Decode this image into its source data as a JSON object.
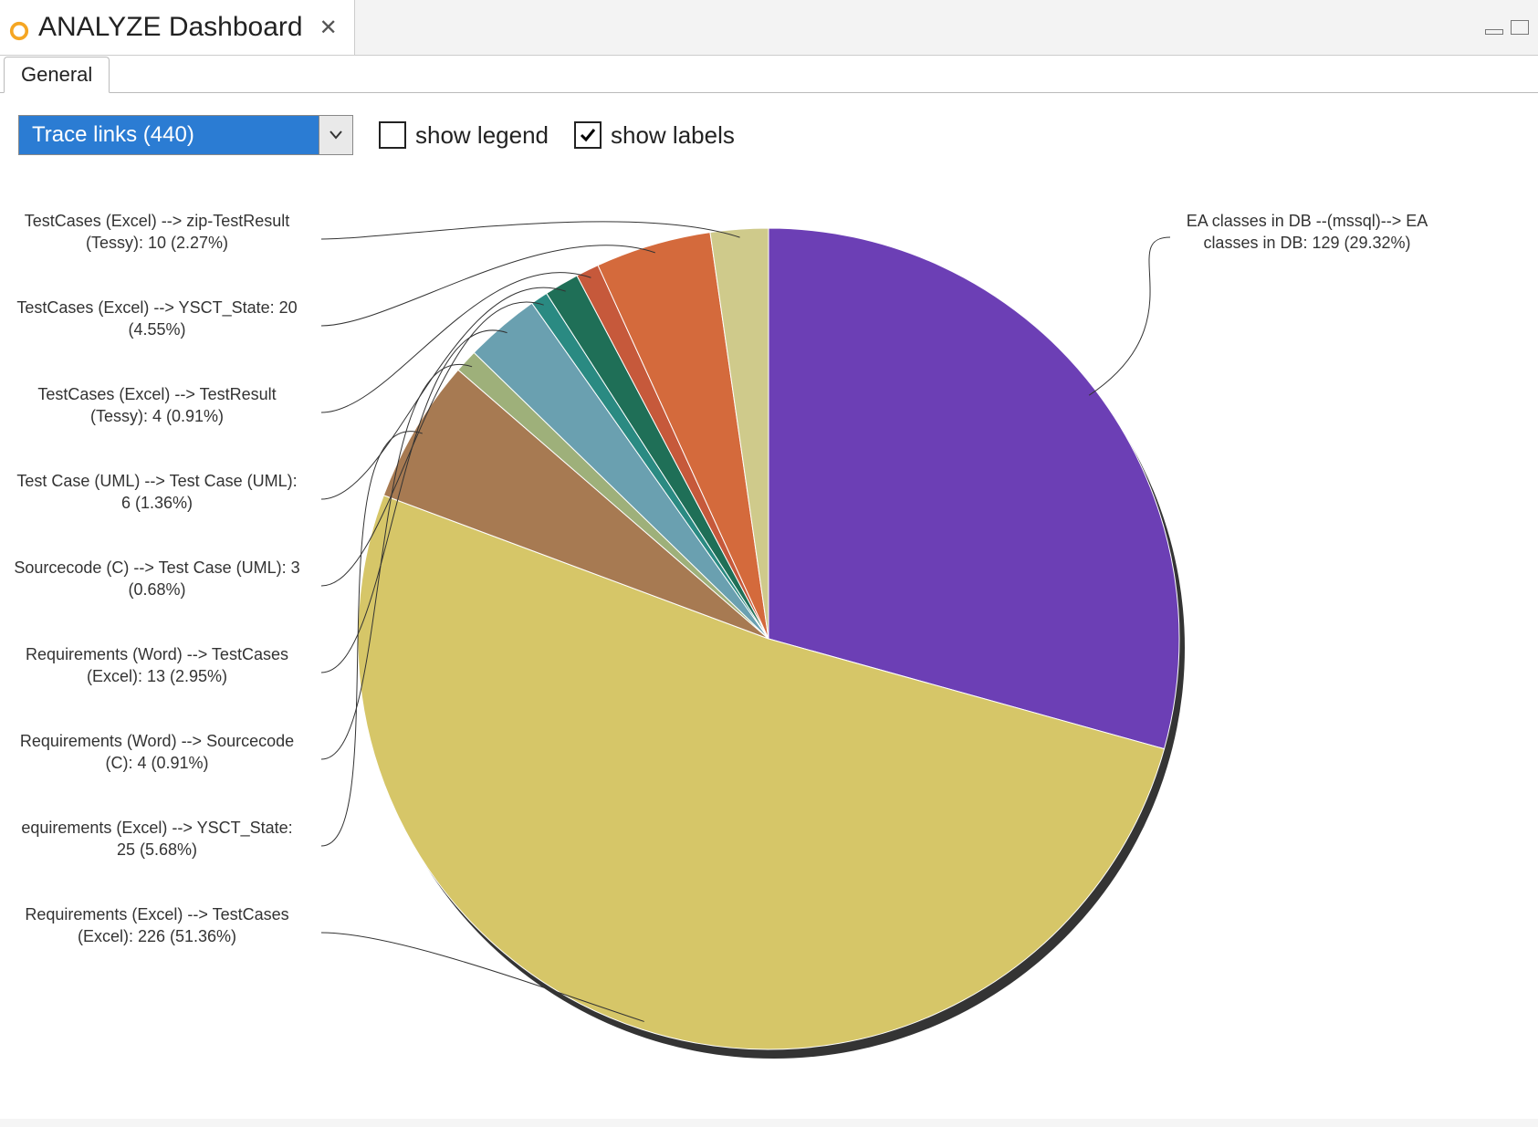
{
  "window": {
    "title": "ANALYZE Dashboard"
  },
  "tabs": {
    "general": "General"
  },
  "controls": {
    "combo_value": "Trace links (440)",
    "show_legend": "show legend",
    "show_labels": "show labels"
  },
  "chart_data": {
    "type": "pie",
    "title": "Trace links (440)",
    "total": 440,
    "series": [
      {
        "name": "EA classes in DB --(mssql)--> EA classes in DB",
        "value": 129,
        "percent": 29.32,
        "color": "#6c3fb5"
      },
      {
        "name": "Requirements (Excel) --> TestCases (Excel)",
        "value": 226,
        "percent": 51.36,
        "color": "#d6c668"
      },
      {
        "name": "Requirements (Excel) --> YSCT_State",
        "value": 25,
        "percent": 5.68,
        "color": "#a77a52"
      },
      {
        "name": "Requirements (Word) --> Sourcecode (C)",
        "value": 4,
        "percent": 0.91,
        "color": "#9eb07a"
      },
      {
        "name": "Requirements (Word) --> TestCases (Excel)",
        "value": 13,
        "percent": 2.95,
        "color": "#6aa0b0"
      },
      {
        "name": "Sourcecode (C) --> Test Case (UML)",
        "value": 3,
        "percent": 0.68,
        "color": "#2a8a82"
      },
      {
        "name": "Test Case (UML) --> Test Case (UML)",
        "value": 6,
        "percent": 1.36,
        "color": "#1f6f57"
      },
      {
        "name": "TestCases (Excel) --> TestResult (Tessy)",
        "value": 4,
        "percent": 0.91,
        "color": "#c6593b"
      },
      {
        "name": "TestCases (Excel) --> YSCT_State",
        "value": 20,
        "percent": 4.55,
        "color": "#d46a3c"
      },
      {
        "name": "TestCases (Excel) --> zip-TestResult (Tessy)",
        "value": 10,
        "percent": 2.27,
        "color": "#cfca8b"
      }
    ]
  },
  "labels": {
    "ea": "EA classes in DB --(mssql)--> EA classes in DB: 129 (29.32%)",
    "req_tc_excel": "Requirements (Excel) --> TestCases (Excel): 226 (51.36%)",
    "req_ysct": "equirements (Excel) --> YSCT_State: 25 (5.68%)",
    "reqw_src": "Requirements (Word) --> Sourcecode (C): 4 (0.91%)",
    "reqw_tc": "Requirements (Word) --> TestCases (Excel): 13 (2.95%)",
    "src_uml": "Sourcecode (C) --> Test Case (UML): 3 (0.68%)",
    "uml_uml": "Test Case (UML) --> Test Case (UML): 6 (1.36%)",
    "tc_tr": "TestCases (Excel) --> TestResult (Tessy): 4 (0.91%)",
    "tc_ysct": "TestCases (Excel) --> YSCT_State: 20 (4.55%)",
    "tc_zip": "TestCases (Excel) --> zip-TestResult (Tessy): 10 (2.27%)"
  }
}
